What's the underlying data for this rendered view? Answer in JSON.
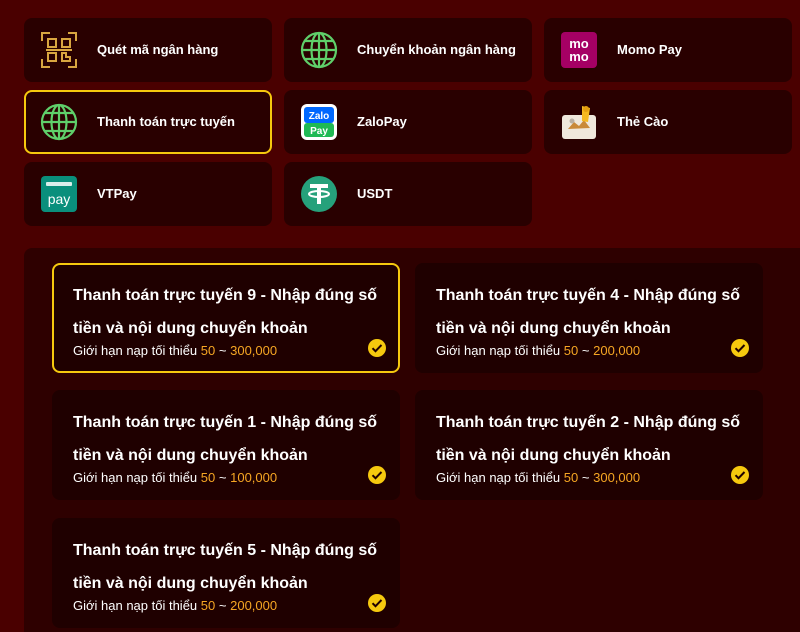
{
  "colors": {
    "page_background": "#4a0000",
    "tile_background": "#290000",
    "accent_border": "#f6c90e",
    "limit_number": "#f6a623",
    "check_badge": "#f6c90e"
  },
  "payment_methods": [
    {
      "label": "Quét mã ngân hàng",
      "icon": "qr-code-icon",
      "active": false
    },
    {
      "label": "Chuyển khoản ngân hàng",
      "icon": "globe-icon",
      "active": false
    },
    {
      "label": "Momo Pay",
      "icon": "momo-logo-icon",
      "logo_text": "mo mo",
      "active": false
    },
    {
      "label": "Thanh toán trực tuyến",
      "icon": "globe-icon",
      "active": true
    },
    {
      "label": "ZaloPay",
      "icon": "zalopay-logo-icon",
      "logo_text": "Zalo Pay",
      "active": false
    },
    {
      "label": "Thẻ Cào",
      "icon": "scratch-card-icon",
      "active": false
    },
    {
      "label": "VTPay",
      "icon": "vtpay-logo-icon",
      "logo_text": "pay",
      "active": false
    },
    {
      "label": "USDT",
      "icon": "tether-logo-icon",
      "active": false
    }
  ],
  "channels": [
    {
      "title": "Thanh toán trực tuyến 9 - Nhập đúng số tiền và nội dung chuyển khoản",
      "limit_prefix": "Giới hạn nạp tối thiểu",
      "min": "50",
      "separator": "~",
      "max": "300,000",
      "active": true
    },
    {
      "title": "Thanh toán trực tuyến 4 - Nhập đúng số tiền và nội dung chuyển khoản",
      "limit_prefix": "Giới hạn nạp tối thiểu",
      "min": "50",
      "separator": "~",
      "max": "200,000",
      "active": false
    },
    {
      "title": "Thanh toán trực tuyến 1 - Nhập đúng số tiền và nội dung chuyển khoản",
      "limit_prefix": "Giới hạn nạp tối thiểu",
      "min": "50",
      "separator": "~",
      "max": "100,000",
      "active": false
    },
    {
      "title": "Thanh toán trực tuyến 2 - Nhập đúng số tiền và nội dung chuyển khoản",
      "limit_prefix": "Giới hạn nạp tối thiểu",
      "min": "50",
      "separator": "~",
      "max": "300,000",
      "active": false
    },
    {
      "title": "Thanh toán trực tuyến 5 - Nhập đúng số tiền và nội dung chuyển khoản",
      "limit_prefix": "Giới hạn nạp tối thiểu",
      "min": "50",
      "separator": "~",
      "max": "200,000",
      "active": false
    }
  ]
}
